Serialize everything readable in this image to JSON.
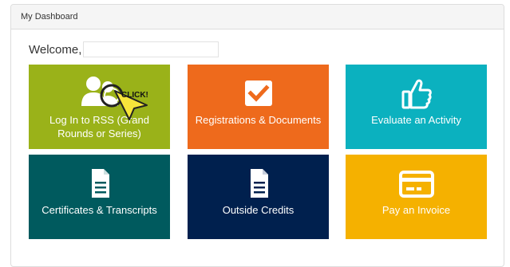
{
  "panel": {
    "title": "My Dashboard"
  },
  "welcome": {
    "label": "Welcome,"
  },
  "tiles": [
    {
      "label": "Log In to RSS (Grand Rounds or Series)",
      "icon": "users-icon",
      "color": "#9ab219"
    },
    {
      "label": "Registrations & Documents",
      "icon": "checkbox-icon",
      "color": "#ee6a1c"
    },
    {
      "label": "Evaluate an Activity",
      "icon": "thumbs-up-icon",
      "color": "#0bb1bf"
    },
    {
      "label": "Certificates & Transcripts",
      "icon": "document-icon",
      "color": "#005a5e"
    },
    {
      "label": "Outside Credits",
      "icon": "document-icon",
      "color": "#00204e"
    },
    {
      "label": "Pay an Invoice",
      "icon": "credit-card-icon",
      "color": "#f5b100"
    }
  ],
  "overlay": {
    "text": "CLICK!"
  }
}
